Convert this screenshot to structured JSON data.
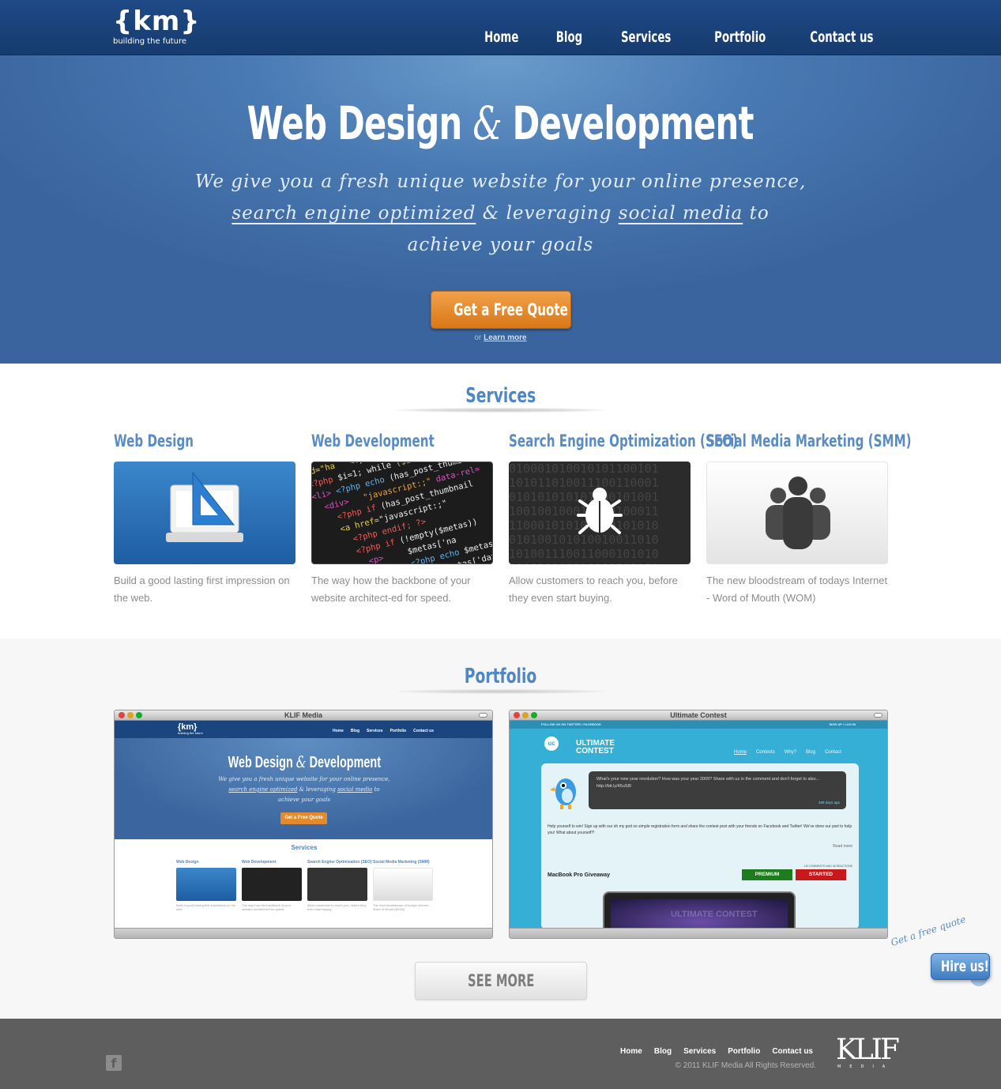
{
  "header": {
    "logo_mark": "{km}",
    "logo_tagline": "building the future",
    "nav": [
      "Home",
      "Blog",
      "Services",
      "Portfolio",
      "Contact us"
    ]
  },
  "hero": {
    "title_left": "Web Design",
    "title_amp": "&",
    "title_right": "Development",
    "subtitle_line1": "We give you a fresh unique website for your online presence,",
    "subtitle_line2_a": "search engine optimized",
    "subtitle_line2_b": " & leveraging ",
    "subtitle_line2_c": "social media",
    "subtitle_line2_d": " to",
    "subtitle_line3": "achieve your goals",
    "cta_label": "Get a Free Quote",
    "or_text": "or",
    "learn_more": "Learn more"
  },
  "services": {
    "title": "Services",
    "items": [
      {
        "title": "Web Design",
        "text": "Build a good lasting first impression on the web."
      },
      {
        "title": "Web Development",
        "text": "The way how the backbone of your website architect-ed for speed."
      },
      {
        "title": "Search Engine Optimization (SEO)",
        "text": "Allow customers to reach you, before they even start buying."
      },
      {
        "title": "Social Media Marketing (SMM)",
        "text": "The new bloodstream of todays Internet - Word of Mouth (WOM)"
      }
    ]
  },
  "portfolio": {
    "title": "Portfolio",
    "windows": [
      {
        "title": "KLIF Media"
      },
      {
        "title": "Ultimate Contest"
      }
    ],
    "see_more": "SEE MORE"
  },
  "ultimate": {
    "top_left": "FOLLOW US ON TWITTER / FACEBOOK",
    "top_right": "SIGN UP / LOG IN",
    "logo": "ULTIMATE CONTEST",
    "nav": [
      "Home",
      "Contests",
      "Why?",
      "Blog",
      "Contact"
    ],
    "tweet": "What's your new year resolution? How was your year 2009? Share with us in the comment and don't forget to also... http://bit.ly/45uS8l",
    "tweet_time": "488 days ago",
    "body": "Help yourself to win! Sign up with our oh my god so simple registration form and share the contest post with your friends on Facebook and Twitter! We've done our part to help you! What about yourself?!",
    "read_more": "Read more",
    "comments": "110 COMMENTS AND 46 REACTIONS",
    "giveaway": "MacBook Pro Giveaway",
    "premium": "PREMIUM",
    "started": "STARTED"
  },
  "hire": {
    "note": "Get a free quote",
    "label": "Hire us!"
  },
  "footer": {
    "nav": [
      "Home",
      "Blog",
      "Services",
      "Portfolio",
      "Contact us"
    ],
    "copyright": "© 2011 KLIF Media All Rights Reserved.",
    "brand": "KLIF",
    "brand_sub": "MEDIA",
    "facebook": "f"
  },
  "colors": {
    "brand_blue": "#1e4a86",
    "accent_orange": "#e88a2a",
    "heading_blue": "#4e87c4",
    "ultimate_cyan": "#35afd6"
  }
}
